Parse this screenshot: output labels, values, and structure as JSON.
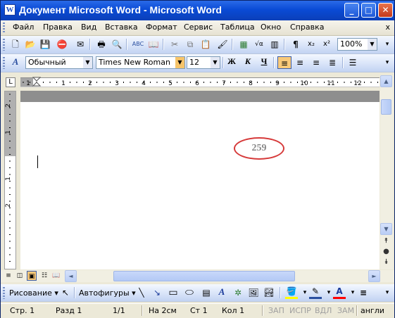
{
  "window": {
    "title": "Документ Microsoft Word - Microsoft Word",
    "icon_letter": "W",
    "controls": [
      "_",
      "□",
      "✕"
    ]
  },
  "menu": {
    "items": [
      "Файл",
      "Правка",
      "Вид",
      "Вставка",
      "Формат",
      "Сервис",
      "Таблица",
      "Окно",
      "Справка"
    ],
    "close": "x"
  },
  "standard_toolbar": {
    "zoom": "100%"
  },
  "formatting_toolbar": {
    "style": "Обычный",
    "font": "Times New Roman",
    "size": "12",
    "bold": "Ж",
    "italic": "К",
    "underline": "Ч"
  },
  "ruler": {
    "numbers": [
      "1",
      "1",
      "2",
      "3",
      "4",
      "5",
      "6",
      "7",
      "8",
      "9",
      "10",
      "11",
      "12"
    ],
    "vertical_numbers": [
      "2",
      "1",
      "1",
      "2"
    ]
  },
  "document": {
    "stamp": "259"
  },
  "drawing_toolbar": {
    "draw": "Рисование",
    "autoshapes": "Автофигуры"
  },
  "status": {
    "page": "Стр. 1",
    "section": "Разд 1",
    "pages": "1/1",
    "at": "На 2см",
    "line": "Ст 1",
    "col": "Кол 1",
    "rec": "ЗАП",
    "trk": "ИСПР",
    "ext": "ВДЛ",
    "ovr": "ЗАМ",
    "lang": "англи"
  },
  "colors": {
    "titlebar": "#0a4bd6",
    "stamp_circle": "#d63a3a",
    "highlight_fill": "#ffff00",
    "font_color": "#ff0000"
  }
}
